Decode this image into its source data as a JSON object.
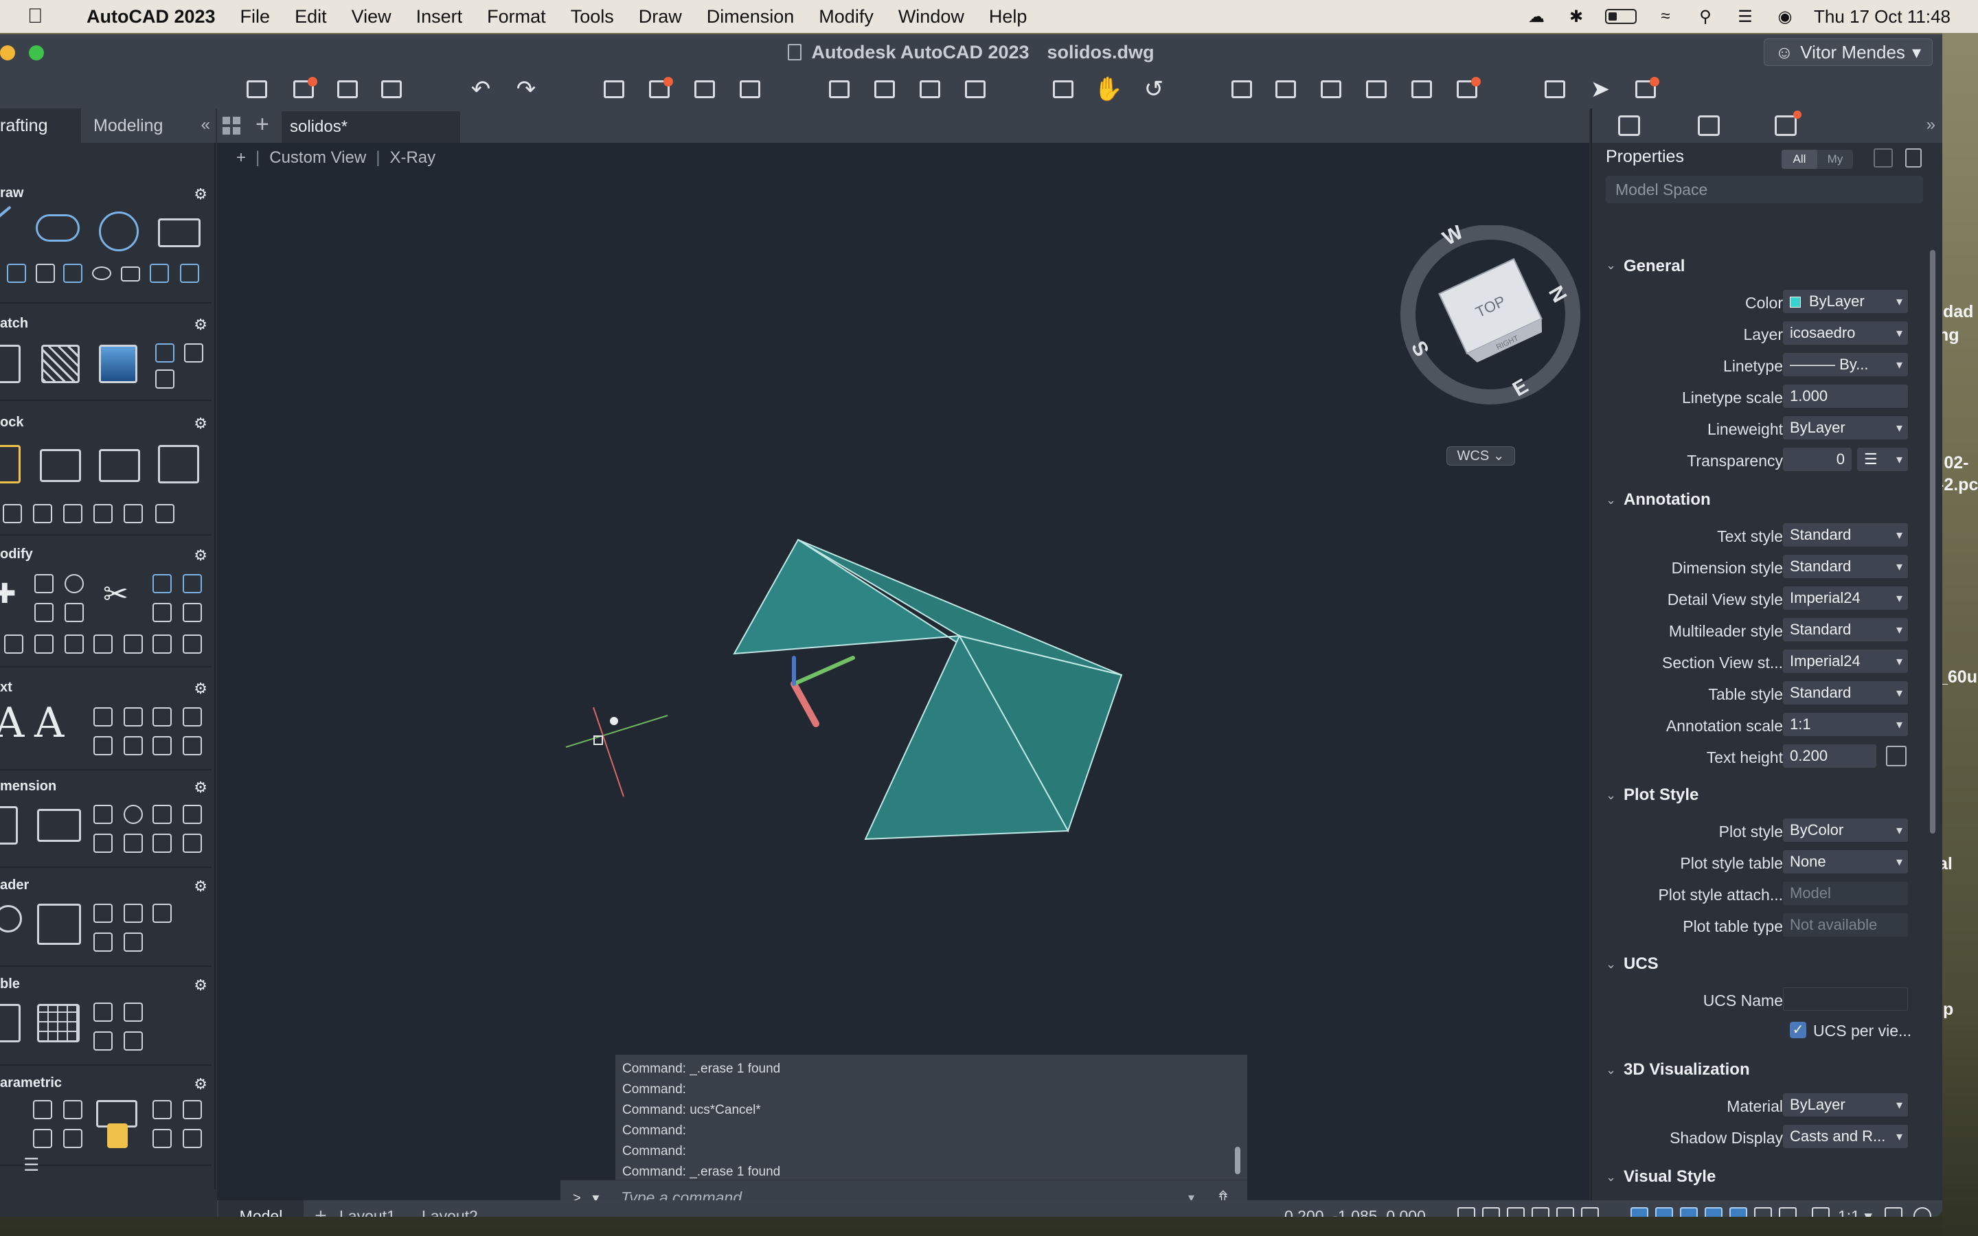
{
  "menubar": {
    "app_name": "AutoCAD 2023",
    "items": [
      "File",
      "Edit",
      "View",
      "Insert",
      "Format",
      "Tools",
      "Draw",
      "Dimension",
      "Modify",
      "Window",
      "Help"
    ],
    "datetime": "Thu 17 Oct  11:48"
  },
  "window": {
    "title": "Autodesk AutoCAD 2023",
    "filename": "solidos.dwg",
    "user": "Vitor Mendes"
  },
  "palette": {
    "tabs": [
      "rafting",
      "Modeling"
    ],
    "sections": [
      "raw",
      "atch",
      "ock",
      "odify",
      "xt",
      "mension",
      "ader",
      "ble",
      "arametric"
    ]
  },
  "file_tab": "solidos*",
  "viewport": {
    "plus": "+",
    "view": "Custom View",
    "style": "X-Ray",
    "wcs": "WCS ⌄",
    "viewcube": {
      "face": "TOP",
      "side": "RIGHT",
      "compass": [
        "W",
        "N",
        "E",
        "S"
      ]
    }
  },
  "command": {
    "history": [
      "Command: _.erase 1 found",
      "Command:",
      "Command: ucs*Cancel*",
      "Command:",
      "Command:",
      "Command: _.erase 1 found"
    ],
    "prompt": ">_ ▾",
    "placeholder": "Type a command"
  },
  "statusbar": {
    "layouts": [
      "Model",
      "Layout1",
      "Layout2"
    ],
    "coords": "0.200, -1.085, 0.000",
    "scale": "1:1 ▾"
  },
  "properties": {
    "title": "Properties",
    "filter_all": "All",
    "filter_my": "My",
    "selection": "Model Space",
    "groups": {
      "general": "General",
      "annotation": "Annotation",
      "plot_style": "Plot Style",
      "ucs": "UCS",
      "viz3d": "3D Visualization",
      "visual_style": "Visual Style"
    },
    "general": [
      {
        "label": "Color",
        "value": "ByLayer"
      },
      {
        "label": "Layer",
        "value": "icosaedro"
      },
      {
        "label": "Linetype",
        "value": "——— By..."
      },
      {
        "label": "Linetype scale",
        "value": "1.000"
      },
      {
        "label": "Lineweight",
        "value": "ByLayer"
      },
      {
        "label": "Transparency",
        "value": "0"
      }
    ],
    "annotation": [
      {
        "label": "Text style",
        "value": "Standard"
      },
      {
        "label": "Dimension style",
        "value": "Standard"
      },
      {
        "label": "Detail View style",
        "value": "Imperial24"
      },
      {
        "label": "Multileader style",
        "value": "Standard"
      },
      {
        "label": "Section View st...",
        "value": "Imperial24"
      },
      {
        "label": "Table style",
        "value": "Standard"
      },
      {
        "label": "Annotation scale",
        "value": "1:1"
      },
      {
        "label": "Text height",
        "value": "0.200"
      }
    ],
    "plot_style": [
      {
        "label": "Plot style",
        "value": "ByColor"
      },
      {
        "label": "Plot style table",
        "value": "None"
      },
      {
        "label": "Plot style attach...",
        "value": "Model"
      },
      {
        "label": "Plot table type",
        "value": "Not available"
      }
    ],
    "ucs": [
      {
        "label": "UCS Name",
        "value": ""
      },
      {
        "label": "UCS per vie...",
        "value": "checked"
      }
    ],
    "viz3d": [
      {
        "label": "Material",
        "value": "ByLayer"
      },
      {
        "label": "Shadow Display",
        "value": "Casts and R..."
      }
    ]
  },
  "desktop_fragments": [
    "idad",
    "ng",
    ":02-",
    "-2.pc",
    "_60u",
    "al",
    ".p"
  ],
  "colors": {
    "accent": "#3e7fc2",
    "solid_face": "#2a7a78",
    "notification": "#f0603a"
  }
}
